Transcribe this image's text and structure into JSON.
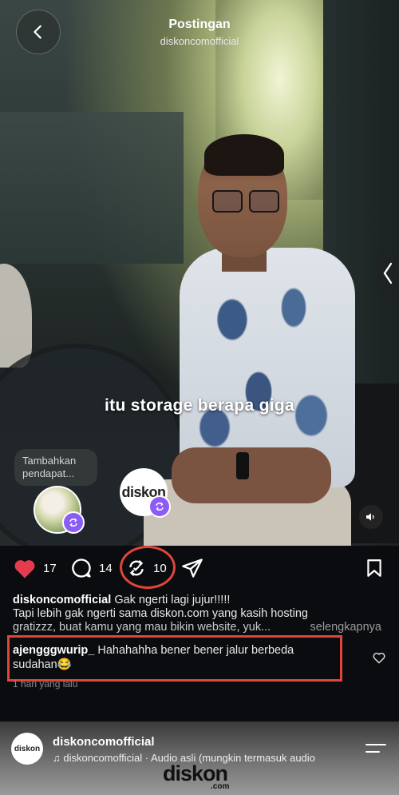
{
  "header": {
    "title": "Postingan",
    "subtitle": "diskoncomofficial"
  },
  "video": {
    "caption": "itu storage berapa giga",
    "note_placeholder": "Tambahkan pendapat...",
    "brand_logo_text": "diskon"
  },
  "actions": {
    "likes": "17",
    "comments": "14",
    "reposts": "10"
  },
  "post": {
    "username": "diskoncomofficial",
    "caption_line1": "Gak ngerti lagi jujur!!!!!",
    "caption_line2": "Tapi lebih gak ngerti sama diskon.com yang kasih hosting",
    "caption_line3": "gratizzz, buat kamu yang mau bikin website, yuk...",
    "more_label": "selengkapnya"
  },
  "comment": {
    "username": "ajengggwurip_",
    "text": "Hahahahha bener bener jalur berbeda sudahan😂",
    "time": "1 hari yang lalu"
  },
  "next_post": {
    "username": "diskoncomofficial",
    "audio": "diskoncomofficial · Audio asli  (mungkin termasuk audio",
    "logo_text": "diskon",
    "logo_sub": ".com",
    "avatar_text": "diskon"
  },
  "colors": {
    "like": "#e53b4f",
    "highlight": "#e0453a",
    "repost_badge": "#8b5cf6",
    "brand_green": "#2a9d3e"
  }
}
